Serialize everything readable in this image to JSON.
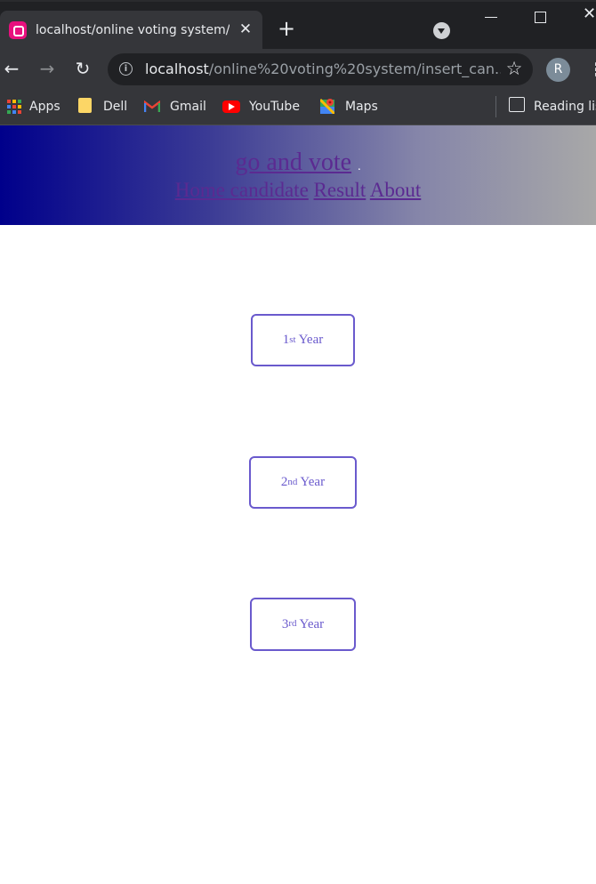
{
  "browser": {
    "tab": {
      "title": "localhost/online voting system/ir"
    },
    "address": {
      "host": "localhost",
      "path": "/online%20voting%20system/insert_can..."
    },
    "profile_initial": "R",
    "bookmarks": [
      {
        "label": "Apps",
        "icon": "apps-grid-icon"
      },
      {
        "label": "Dell",
        "icon": "folder-icon"
      },
      {
        "label": "Gmail",
        "icon": "gmail-icon"
      },
      {
        "label": "YouTube",
        "icon": "youtube-icon"
      },
      {
        "label": "Maps",
        "icon": "maps-icon"
      }
    ],
    "reading_list": "Reading lis"
  },
  "site": {
    "brand": "go and vote",
    "brand_suffix": ".",
    "nav": [
      {
        "label": "Home candidate"
      },
      {
        "label": "Result"
      },
      {
        "label": "About"
      }
    ],
    "header_gradient": [
      "#00008b",
      "#a8a8a8"
    ],
    "link_color": "#5b2a91"
  },
  "years": [
    {
      "num": "1",
      "suffix": "st",
      "word": "Year"
    },
    {
      "num": "2",
      "suffix": "nd",
      "word": "Year"
    },
    {
      "num": "3",
      "suffix": "rd",
      "word": "Year"
    }
  ],
  "colors": {
    "button_border": "#6a5acd",
    "button_text": "#6a5acd"
  }
}
